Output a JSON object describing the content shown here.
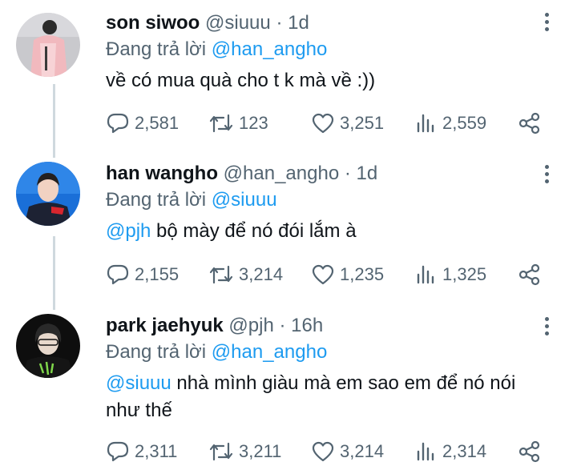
{
  "reply_prefix": "Đang trả lời",
  "tweets": [
    {
      "name": "son siwoo",
      "handle": "@siuuu",
      "separator": "·",
      "time": "1d",
      "replying_to": "@han_angho",
      "mention": "",
      "text": "về có mua quà cho t k mà về :))",
      "replies": "2,581",
      "retweets": "123",
      "likes": "3,251",
      "views": "2,559"
    },
    {
      "name": "han wangho",
      "handle": "@han_angho",
      "separator": "·",
      "time": "1d",
      "replying_to": "@siuuu",
      "mention": "@pjh",
      "text": " bộ mày để nó đói lắm à",
      "replies": "2,155",
      "retweets": "3,214",
      "likes": "1,235",
      "views": "1,325"
    },
    {
      "name": "park jaehyuk",
      "handle": "@pjh",
      "separator": "·",
      "time": "16h",
      "replying_to": "@han_angho",
      "mention": "@siuuu",
      "text": " nhà mình giàu mà em sao em để nó nói như thế",
      "replies": "2,311",
      "retweets": "3,211",
      "likes": "3,214",
      "views": "2,314"
    }
  ],
  "icons": {
    "reply": "reply-icon",
    "retweet": "retweet-icon",
    "like": "heart-icon",
    "views": "views-chart-icon",
    "share": "share-icon",
    "more": "more-vertical-icon"
  },
  "colors": {
    "text": "#0f1419",
    "secondary": "#536471",
    "link": "#1d9bf0",
    "thread_line": "#cfd9de"
  }
}
